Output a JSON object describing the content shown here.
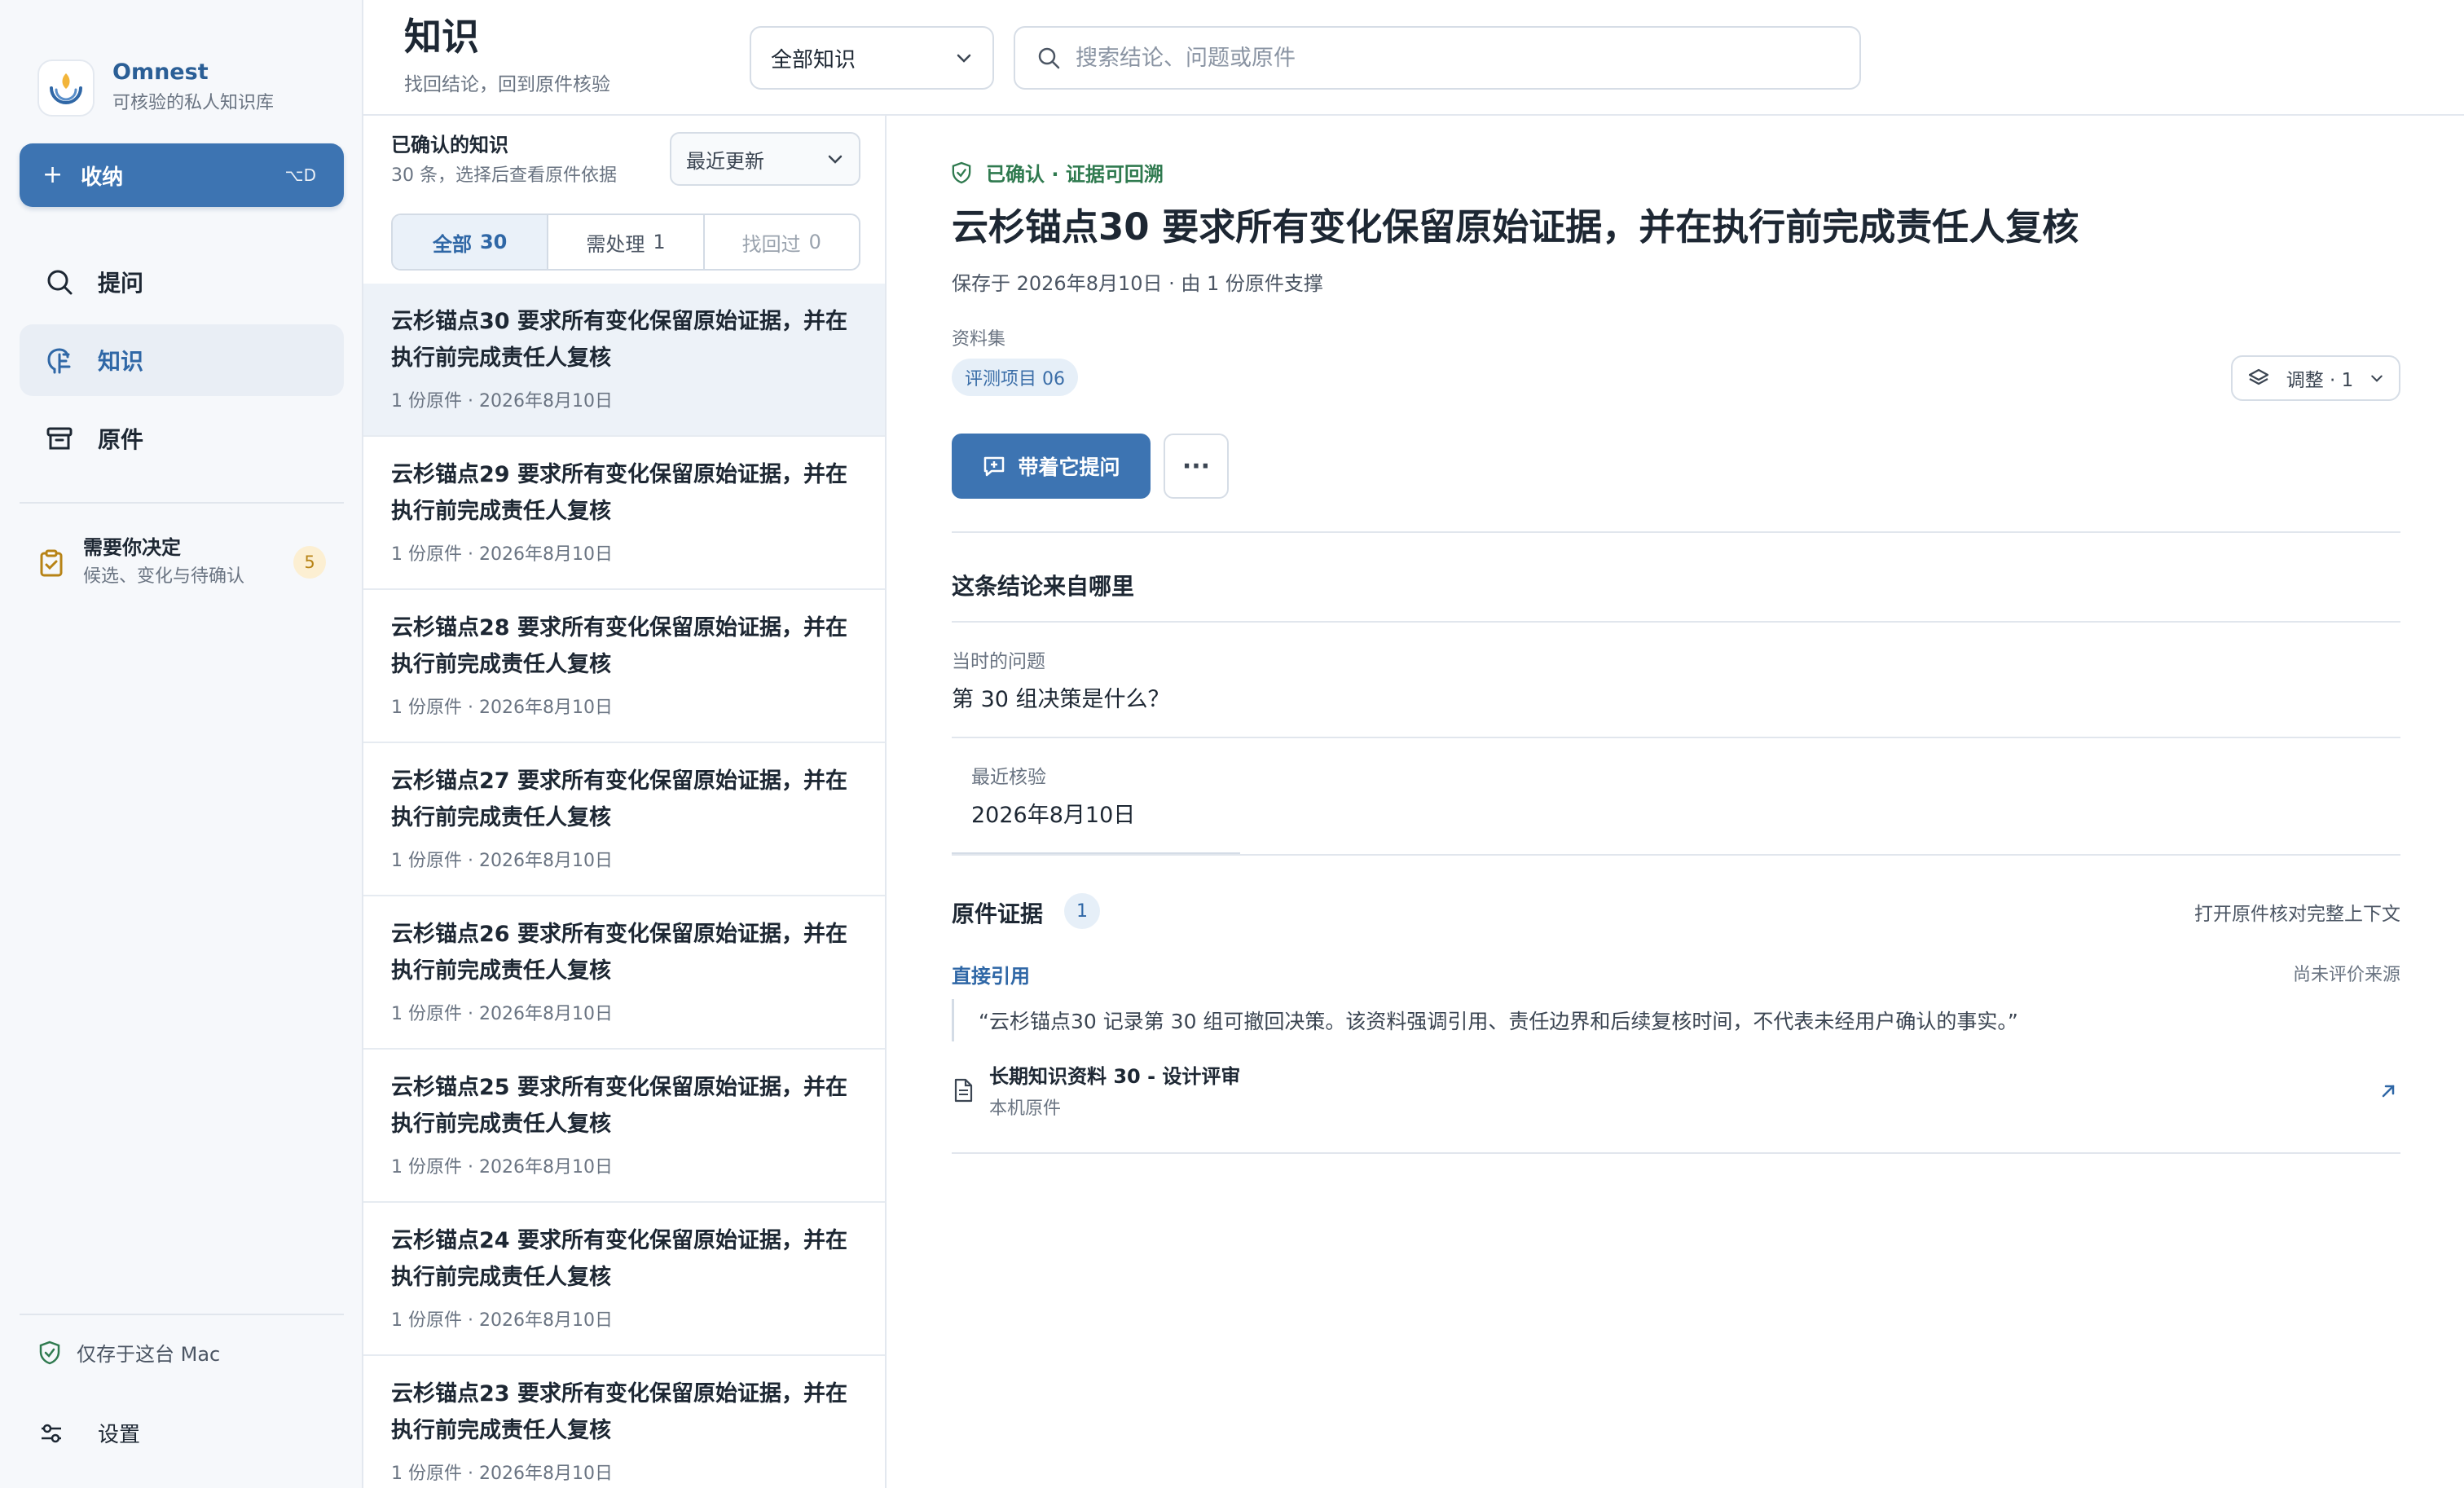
{
  "brand": {
    "name": "Omnest",
    "tagline": "可核验的私人知识库"
  },
  "sidebar": {
    "capture": {
      "label": "收纳",
      "shortcut": "⌥D"
    },
    "nav": [
      {
        "label": "提问",
        "icon": "search-icon",
        "active": false
      },
      {
        "label": "知识",
        "icon": "brain-icon",
        "active": true
      },
      {
        "label": "原件",
        "icon": "archive-icon",
        "active": false
      }
    ],
    "decide": {
      "title": "需要你决定",
      "subtitle": "候选、变化与待确认",
      "count": "5"
    },
    "local_only": "仅存于这台 Mac",
    "settings": "设置"
  },
  "header": {
    "title": "知识",
    "subtitle": "找回结论，回到原件核验",
    "scope": "全部知识",
    "search_placeholder": "搜索结论、问题或原件"
  },
  "list": {
    "title": "已确认的知识",
    "subtitle": "30 条，选择后查看原件依据",
    "sort": "最近更新",
    "filters": [
      {
        "label": "全部",
        "count": "30",
        "active": true
      },
      {
        "label": "需处理",
        "count": "1",
        "active": false
      },
      {
        "label": "找回过",
        "count": "0",
        "active": false
      }
    ],
    "items": [
      {
        "title": "云杉锚点30 要求所有变化保留原始证据，并在执行前完成责任人复核",
        "meta": "1 份原件 · 2026年8月10日"
      },
      {
        "title": "云杉锚点29 要求所有变化保留原始证据，并在执行前完成责任人复核",
        "meta": "1 份原件 · 2026年8月10日"
      },
      {
        "title": "云杉锚点28 要求所有变化保留原始证据，并在执行前完成责任人复核",
        "meta": "1 份原件 · 2026年8月10日"
      },
      {
        "title": "云杉锚点27 要求所有变化保留原始证据，并在执行前完成责任人复核",
        "meta": "1 份原件 · 2026年8月10日"
      },
      {
        "title": "云杉锚点26 要求所有变化保留原始证据，并在执行前完成责任人复核",
        "meta": "1 份原件 · 2026年8月10日"
      },
      {
        "title": "云杉锚点25 要求所有变化保留原始证据，并在执行前完成责任人复核",
        "meta": "1 份原件 · 2026年8月10日"
      },
      {
        "title": "云杉锚点24 要求所有变化保留原始证据，并在执行前完成责任人复核",
        "meta": "1 份原件 · 2026年8月10日"
      },
      {
        "title": "云杉锚点23 要求所有变化保留原始证据，并在执行前完成责任人复核",
        "meta": "1 份原件 · 2026年8月10日"
      }
    ]
  },
  "detail": {
    "status": "已确认 · 证据可回溯",
    "title": "云杉锚点30 要求所有变化保留原始证据，并在执行前完成责任人复核",
    "meta": "保存于 2026年8月10日 · 由 1 份原件支撑",
    "collection_label": "资料集",
    "collection_tag": "评测项目 06",
    "adjust": "调整 · 1",
    "ask_button": "带着它提问",
    "origin_title": "这条结论来自哪里",
    "question_label": "当时的问题",
    "question_value": "第 30 组决策是什么？",
    "verify_label": "最近核验",
    "verify_value": "2026年8月10日",
    "evidence": {
      "title": "原件证据",
      "count": "1",
      "open_link": "打开原件核对完整上下文",
      "type": "直接引用",
      "rating": "尚未评价来源",
      "quote": "“云杉锚点30 记录第 30 组可撤回决策。该资料强调引用、责任边界和后续复核时间，不代表未经用户确认的事实。”",
      "source_title": "长期知识资料 30 - 设计评审",
      "source_sub": "本机原件"
    }
  },
  "colors": {
    "accent": "#3d74b2",
    "success": "#2f7a4f",
    "badge_warn": "#b78316"
  }
}
